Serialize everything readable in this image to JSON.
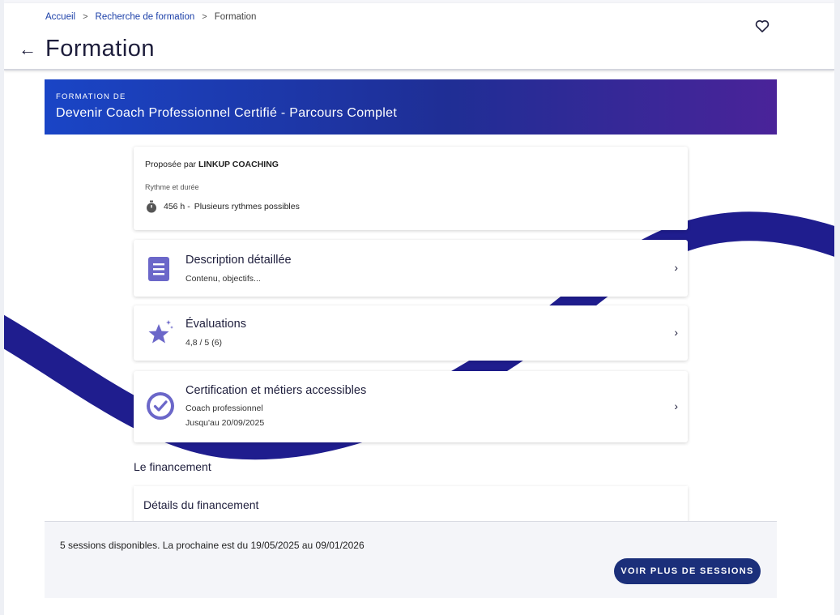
{
  "breadcrumb": {
    "items": [
      "Accueil",
      "Recherche de formation"
    ],
    "current": "Formation",
    "separator": ">"
  },
  "header": {
    "title": "Formation",
    "back_glyph": "←",
    "favorite_icon": "heart-outline-icon"
  },
  "banner": {
    "label": "FORMATION DE",
    "title": "Devenir Coach Professionnel Certifié - Parcours Complet"
  },
  "info": {
    "offered_prefix": "Proposée par",
    "provider": "LINKUP COACHING",
    "rhythm_label": "Rythme et durée",
    "hours": "456 h -",
    "rhythm": "Plusieurs rythmes possibles"
  },
  "sections": [
    {
      "title": "Description détaillée",
      "subtitle": "Contenu, objectifs...",
      "icon": "document-icon"
    },
    {
      "title": "Évaluations",
      "subtitle": "4,8 / 5 (6)",
      "icon": "star-icon"
    },
    {
      "title": "Certification et métiers accessibles",
      "subtitle": "Coach professionnel",
      "subtitle2": "Jusqu'au 20/09/2025",
      "icon": "certified-badge-icon"
    }
  ],
  "chevron": "›",
  "financing": {
    "heading": "Le financement",
    "details_title": "Détails du financement"
  },
  "sessions": {
    "text": "5 sessions disponibles. La prochaine est du 19/05/2025 au 09/01/2026",
    "button_label": "VOIR PLUS DE SESSIONS"
  },
  "colors": {
    "accent": "#1b2f7a",
    "link": "#1b3fa8",
    "wave": "#1f1d8e",
    "banner_start": "#1a45c6",
    "banner_end": "#4a2399"
  }
}
